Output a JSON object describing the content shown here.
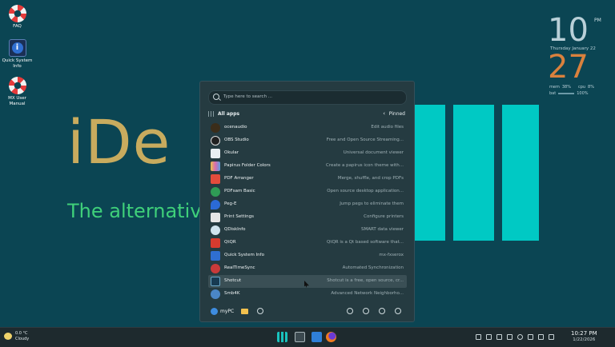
{
  "desktop_icons": [
    {
      "label": "FAQ",
      "icon": "lifebuoy-icon"
    },
    {
      "label": "Quick System Info",
      "icon": "info-icon"
    },
    {
      "label": "MX User Manual",
      "icon": "lifebuoy-icon"
    }
  ],
  "wallpaper": {
    "title": "iDe",
    "subtitle": "The alternative"
  },
  "clock": {
    "hour": "10",
    "ampm": "PM",
    "date": "Thursday  January 22",
    "minute": "27",
    "mem_label": "mem",
    "mem_value": "38%",
    "cpu_label": "cpu",
    "cpu_value": "8%",
    "bat_label": "bat",
    "bat_value": "100%"
  },
  "menu": {
    "search_placeholder": "Type here to search ...",
    "all_apps": "All apps",
    "pinned": "Pinned",
    "apps": [
      {
        "name": "ocenaudio",
        "desc": "Edit audio files",
        "color": "#3b2d1a"
      },
      {
        "name": "OBS Studio",
        "desc": "Free and Open Source Streaming...",
        "color": "#202020"
      },
      {
        "name": "Okular",
        "desc": "Universal document viewer",
        "color": "#e9eef2"
      },
      {
        "name": "Papirus Folder Colors",
        "desc": "Create a papirus icon theme with...",
        "color": "#d86bb0"
      },
      {
        "name": "PDF Arranger",
        "desc": "Merge, shuffle, and crop PDFs",
        "color": "#e34c3c"
      },
      {
        "name": "PDFsam Basic",
        "desc": "Open source desktop application...",
        "color": "#2f9c55"
      },
      {
        "name": "Peg-E",
        "desc": "Jump pegs to eliminate them",
        "color": "#2b6ad6"
      },
      {
        "name": "Print Settings",
        "desc": "Configure printers",
        "color": "#e6e6e6"
      },
      {
        "name": "QDiskInfo",
        "desc": "SMART data viewer",
        "color": "#4a9ed6"
      },
      {
        "name": "QtQR",
        "desc": "QtQR is a Qt based software that...",
        "color": "#d63b2f"
      },
      {
        "name": "Quick System Info",
        "desc": "mx-fxserox",
        "color": "#2f6fd1"
      },
      {
        "name": "RealTimeSync",
        "desc": "Automated Synchronization",
        "color": "#c83a3a"
      },
      {
        "name": "Shotcut",
        "desc": "Shotcut is a free, open source, cr...",
        "color": "#173b52"
      },
      {
        "name": "Smb4K",
        "desc": "Advanced Network Neighborho...",
        "color": "#4a86c6"
      }
    ],
    "user": "myPC"
  },
  "taskbar": {
    "temp": "0.0 °C",
    "weather": "Cloudy",
    "time": "10:27 PM",
    "date": "1/22/2026"
  }
}
